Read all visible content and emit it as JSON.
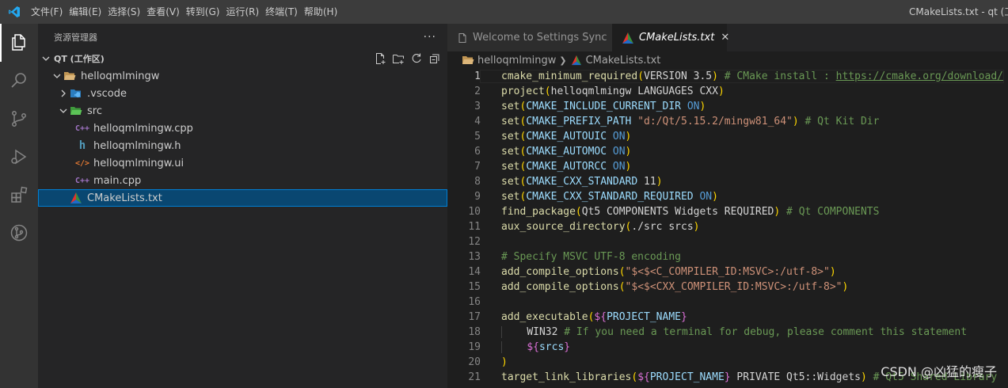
{
  "titlebar": {
    "menu": [
      "文件(F)",
      "编辑(E)",
      "选择(S)",
      "查看(V)",
      "转到(G)",
      "运行(R)",
      "终端(T)",
      "帮助(H)"
    ],
    "window_title": "CMakeLists.txt - qt (工作区)"
  },
  "activity_icons": [
    "explorer-icon",
    "search-icon",
    "source-control-icon",
    "run-debug-icon",
    "extensions-icon",
    "git-graph-icon"
  ],
  "sidebar": {
    "title": "资源管理器",
    "more": "···",
    "workspace": "QT (工作区)",
    "tree": [
      {
        "label": "helloqmlmingw",
        "depth": 1,
        "type": "folder-open"
      },
      {
        "label": ".vscode",
        "depth": 2,
        "type": "folder-closed"
      },
      {
        "label": "src",
        "depth": 2,
        "type": "folder-open"
      },
      {
        "label": "helloqmlmingw.cpp",
        "depth": 3,
        "type": "cpp"
      },
      {
        "label": "helloqmlmingw.h",
        "depth": 3,
        "type": "h"
      },
      {
        "label": "helloqmlmingw.ui",
        "depth": 3,
        "type": "ui"
      },
      {
        "label": "main.cpp",
        "depth": 3,
        "type": "cpp"
      },
      {
        "label": "CMakeLists.txt",
        "depth": 2,
        "type": "cmake",
        "selected": true
      }
    ]
  },
  "editor": {
    "tabs": [
      {
        "label": "Welcome to Settings Sync",
        "active": false
      },
      {
        "label": "CMakeLists.txt",
        "active": true
      }
    ],
    "close_glyph": "✕",
    "breadcrumb": [
      "helloqmlmingw",
      "CMakeLists.txt"
    ],
    "lines": [
      "1",
      "2",
      "3",
      "4",
      "5",
      "6",
      "7",
      "8",
      "9",
      "10",
      "11",
      "12",
      "13",
      "14",
      "15",
      "16",
      "17",
      "18",
      "19",
      "20",
      "21"
    ]
  },
  "watermark": "CSDN @凶猛的瘦子",
  "colors": {
    "accent": "#007acc",
    "selection": "#094771",
    "comment": "#6a9955",
    "function": "#dcdcaa",
    "variable": "#9cdcfe",
    "keyword": "#569cd6",
    "string": "#ce9178"
  }
}
